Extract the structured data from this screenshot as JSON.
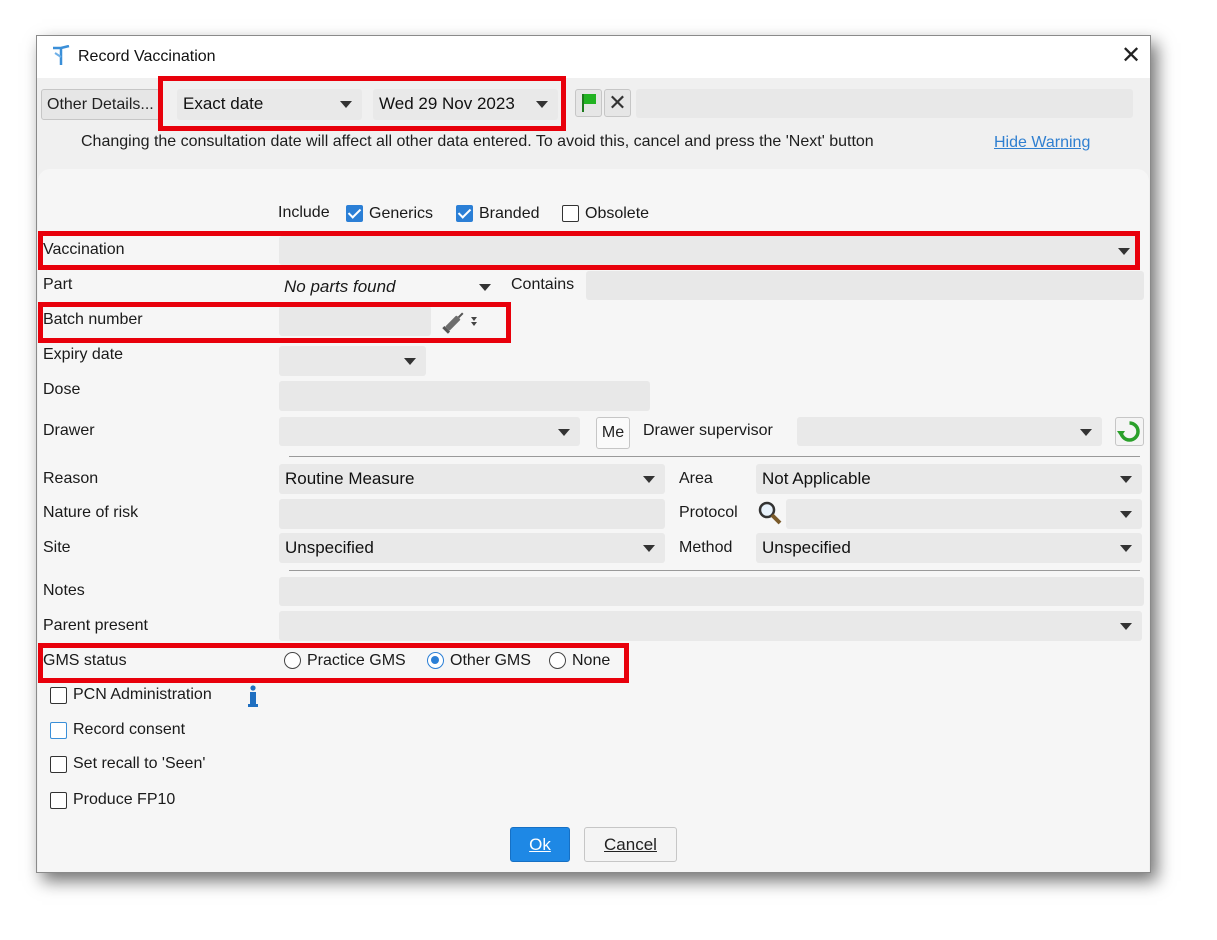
{
  "window": {
    "title": "Record Vaccination"
  },
  "toolbar": {
    "other_details_label": "Other Details...",
    "date_mode": "Exact date",
    "date_value": "Wed 29 Nov 2023"
  },
  "warning": {
    "text": "Changing the consultation date will affect all other data entered. To avoid this, cancel and press the 'Next' button",
    "hide_link": "Hide Warning"
  },
  "include": {
    "label": "Include",
    "generics": {
      "label": "Generics",
      "checked": true
    },
    "branded": {
      "label": "Branded",
      "checked": true
    },
    "obsolete": {
      "label": "Obsolete",
      "checked": false
    }
  },
  "form": {
    "vaccination_label": "Vaccination",
    "vaccination_value": "",
    "part_label": "Part",
    "part_value": "No parts found",
    "contains_label": "Contains",
    "batch_label": "Batch number",
    "expiry_label": "Expiry date",
    "dose_label": "Dose",
    "drawer_label": "Drawer",
    "me_button": "Me",
    "drawer_supervisor_label": "Drawer supervisor",
    "reason_label": "Reason",
    "reason_value": "Routine Measure",
    "area_label": "Area",
    "area_value": "Not Applicable",
    "nature_label": "Nature of risk",
    "protocol_label": "Protocol",
    "site_label": "Site",
    "site_value": "Unspecified",
    "method_label": "Method",
    "method_value": "Unspecified",
    "notes_label": "Notes",
    "parent_label": "Parent present",
    "gms_label": "GMS status",
    "gms_options": [
      "Practice GMS",
      "Other GMS",
      "None"
    ],
    "gms_selected": "Other GMS"
  },
  "options": {
    "pcn": "PCN Administration",
    "consent": "Record consent",
    "recall": "Set recall to 'Seen'",
    "fp10": "Produce FP10"
  },
  "buttons": {
    "ok": "Ok",
    "cancel": "Cancel"
  },
  "colors": {
    "highlight": "#e8000b",
    "accent": "#2b7fd6",
    "ok_bg": "#1e88e5"
  },
  "icons": [
    "app-logo-icon",
    "close-icon",
    "green-flag-icon",
    "clear-x-icon",
    "syringe-icon",
    "refresh-icon",
    "magnifier-icon",
    "info-icon",
    "chevron-down-icon"
  ]
}
